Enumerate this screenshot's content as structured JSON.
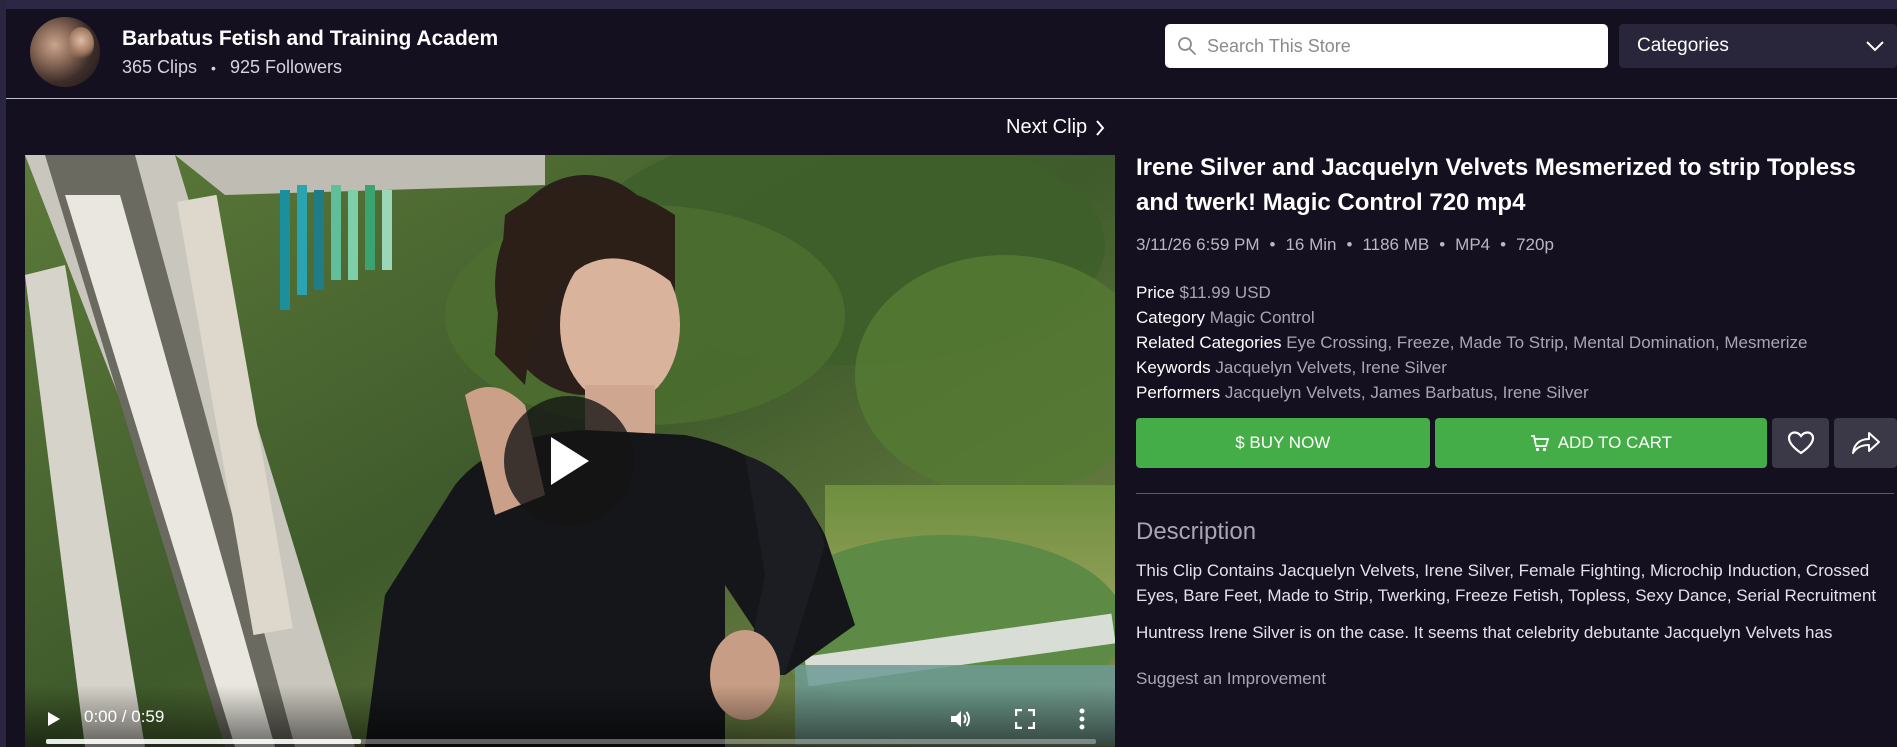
{
  "store": {
    "name": "Barbatus Fetish and Training Academ",
    "clips": "365 Clips",
    "separator": "•",
    "followers": "925 Followers"
  },
  "search": {
    "placeholder": "Search This Store",
    "value": ""
  },
  "categories_select": {
    "label": "Categories"
  },
  "next_clip": {
    "label": "Next Clip"
  },
  "video": {
    "time": "0:00 / 0:59",
    "progress_fraction": 0.3
  },
  "clip": {
    "title": "Irene Silver and Jacquelyn Velvets Mesmerized to strip Topless and twerk! Magic Control 720 mp4",
    "meta": [
      "3/11/26 6:59 PM",
      "16 Min",
      "1186 MB",
      "MP4",
      "720p"
    ],
    "meta_separator": "•",
    "price_label": "Price",
    "price_value": "$11.99 USD",
    "category_label": "Category",
    "category_value": "Magic Control",
    "related_label": "Related Categories",
    "related_value": "Eye Crossing, Freeze, Made To Strip, Mental Domination, Mesmerize",
    "keywords_label": "Keywords",
    "keywords_value": "Jacquelyn Velvets, Irene Silver",
    "performers_label": "Performers",
    "performers_value": "Jacquelyn Velvets, James Barbatus, Irene Silver"
  },
  "actions": {
    "buy_now": "$ BUY NOW",
    "add_to_cart": "ADD TO CART"
  },
  "description": {
    "heading": "Description",
    "text": "This Clip Contains Jacquelyn Velvets, Irene Silver, Female Fighting, Microchip Induction, Crossed Eyes, Bare Feet, Made to Strip, Twerking, Freeze Fetish, Topless, Sexy Dance, Serial Recruitment",
    "text2": "Huntress Irene Silver is on the case. It seems that celebrity debutante Jacquelyn Velvets has",
    "suggest": "Suggest an Improvement"
  },
  "colors": {
    "background": "#14101f",
    "accent_green": "#45ad48",
    "icon_button": "#3b3848"
  },
  "icons": {
    "search": "search-icon",
    "dropdown": "chevron-down-icon",
    "next": "chevron-right-icon",
    "cart": "cart-icon",
    "wishlist": "heart-icon",
    "share": "share-icon",
    "play": "play-icon",
    "volume": "volume-icon",
    "fullscreen": "fullscreen-icon",
    "more": "more-vertical-icon"
  }
}
